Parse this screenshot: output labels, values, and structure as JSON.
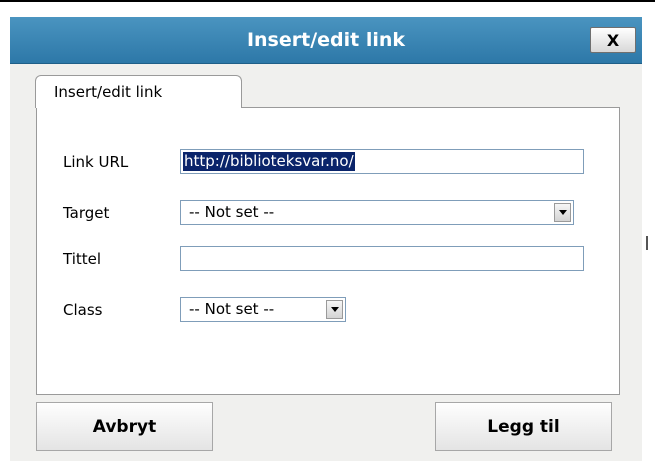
{
  "dialog": {
    "title": "Insert/edit link",
    "close_label": "X",
    "tab_label": "Insert/edit link"
  },
  "form": {
    "link_url": {
      "label": "Link URL",
      "value": "http://biblioteksvar.no/"
    },
    "target": {
      "label": "Target",
      "selected": "-- Not set --"
    },
    "title": {
      "label": "Tittel",
      "value": ""
    },
    "class": {
      "label": "Class",
      "selected": "-- Not set --"
    }
  },
  "buttons": {
    "cancel": "Avbryt",
    "insert": "Legg til"
  },
  "colors": {
    "titlebar": "#3a86b4",
    "selection": "#0a246a"
  }
}
